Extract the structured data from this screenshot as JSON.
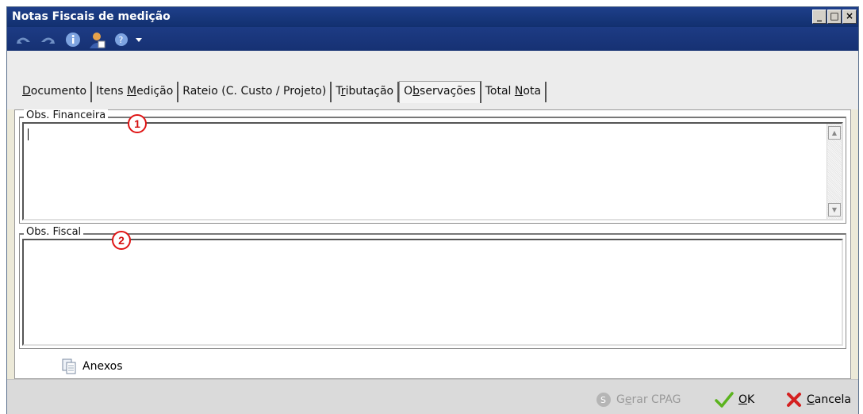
{
  "window": {
    "title": "Notas Fiscais de medição",
    "controls": [
      "minimize",
      "maximize",
      "close"
    ]
  },
  "toolbar": {
    "icons": [
      "undo-icon",
      "redo-icon",
      "info-icon",
      "user-icon",
      "help-icon",
      "dropdown-arrow-icon"
    ]
  },
  "tabs": [
    {
      "pre": "",
      "accel": "D",
      "post": "ocumento"
    },
    {
      "pre": "Itens ",
      "accel": "M",
      "post": "edição"
    },
    {
      "pre": "Rateio (C. Custo / Projeto)",
      "accel": "",
      "post": ""
    },
    {
      "pre": "T",
      "accel": "r",
      "post": "ibutação"
    },
    {
      "pre": "O",
      "accel": "b",
      "post": "servações"
    },
    {
      "pre": "Total ",
      "accel": "N",
      "post": "ota"
    }
  ],
  "active_tab": 4,
  "obs_financeira": {
    "label": "Obs. Financeira",
    "value": "",
    "marker": "1"
  },
  "obs_fiscal": {
    "label": "Obs. Fiscal",
    "value": "",
    "marker": "2"
  },
  "anexos_label": "Anexos",
  "footer": {
    "gerar": {
      "pre": "G",
      "accel": "e",
      "post": "rar CPAG"
    },
    "ok": {
      "pre": "",
      "accel": "O",
      "post": "K"
    },
    "cancela": {
      "pre": "",
      "accel": "C",
      "post": "ancela"
    }
  },
  "colors": {
    "titlebar": "#1e3f8a",
    "marker": "#e01515",
    "ok_check": "#5bb31e",
    "cancel_x": "#d42020"
  }
}
